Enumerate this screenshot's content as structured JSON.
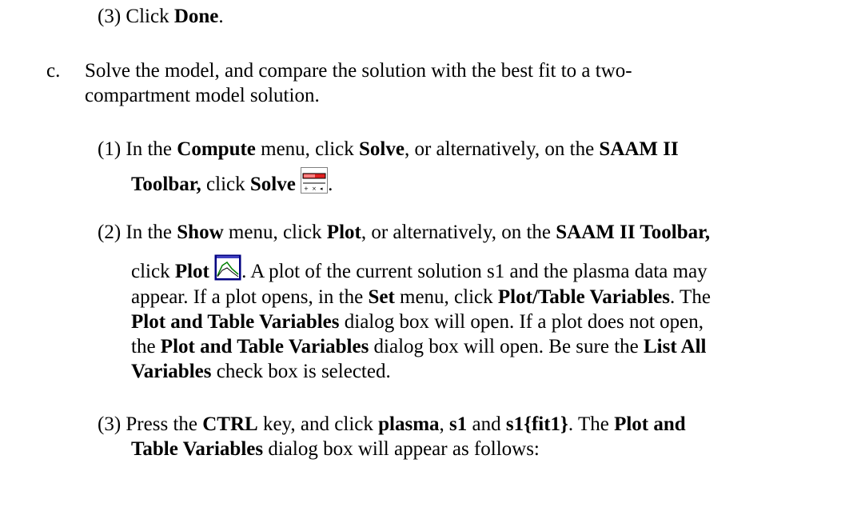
{
  "prev_step": {
    "num": "(3)",
    "pre": "Click",
    "done": "Done",
    "end": "."
  },
  "step_c": {
    "letter": "c.",
    "line1": "Solve the model, and compare the solution with the best fit to a two-",
    "line2": "compartment model solution."
  },
  "sub1": {
    "num": "(1)",
    "t1": "In the",
    "compute": "Compute",
    "t2": "menu, click",
    "solve": "Solve",
    "t3": ", or alternatively, on the",
    "saam": "SAAM II",
    "toolbar": "Toolbar,",
    "t4": "click",
    "solve2": "Solve",
    "end": ".",
    "icon": "solve-toolbar-icon"
  },
  "sub2": {
    "num": "(2)",
    "t1": "In the",
    "show": "Show",
    "t2": "menu, click",
    "plot": "Plot",
    "t3": ", or alternatively, on the",
    "saam_toolbar": "SAAM II Toolbar,",
    "t4": "click",
    "plot2": "Plot",
    "t5": ". A plot of the current solution s1 and the plasma data may",
    "l3a": "appear. If a plot opens, in the",
    "set": "Set",
    "l3b": "menu, click",
    "ptv": "Plot/Table Variables",
    "l3c": ". The",
    "l4a": "Plot and Table Variables",
    "l4b": "dialog box will open. If a plot does not open,",
    "l5a": "the",
    "l5b": "Plot and Table Variables",
    "l5c": "dialog box will open. Be sure the",
    "l5d": "List All",
    "l6a": "Variables",
    "l6b": "check box is selected.",
    "icon": "plot-toolbar-icon"
  },
  "sub3": {
    "num": "(3)",
    "t1": "Press the",
    "ctrl": "CTRL",
    "t2": "key, and click",
    "plasma": "plasma",
    "t3": ",",
    "s1": "s1",
    "t4": "and",
    "s1fit": "s1{fit1}",
    "t5": ". The",
    "pat": "Plot and",
    "l2a": "Table Variables",
    "l2b": "dialog box will appear as follows:"
  },
  "colors": {
    "solve_icon_red": "#e02020",
    "plot_icon_navy": "#000080",
    "plot_icon_green": "#008000"
  }
}
